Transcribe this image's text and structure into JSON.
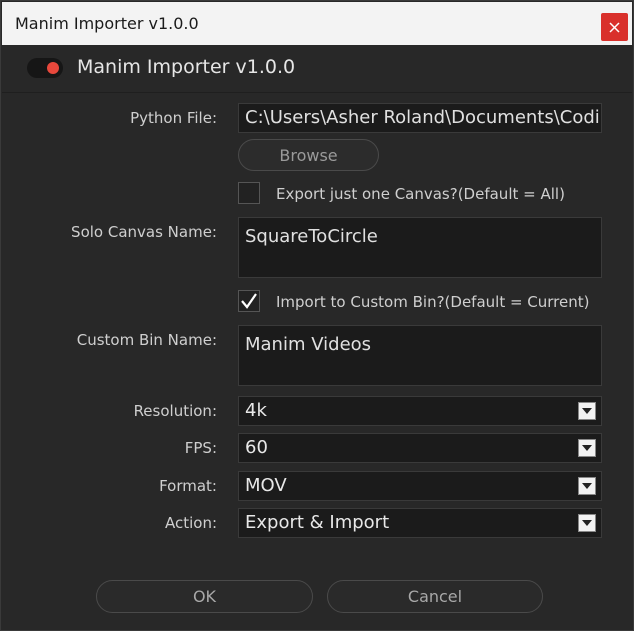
{
  "window": {
    "title": "Manim Importer v1.0.0",
    "close_icon": "close-icon"
  },
  "header": {
    "toggle_icon": "toggle-switch-icon",
    "title": "Manim Importer v1.0.0",
    "accent_color": "#e8483c"
  },
  "form": {
    "python_file": {
      "label": "Python File:",
      "value": "C:\\Users\\Asher Roland\\Documents\\Coding"
    },
    "browse_label": "Browse",
    "export_one_canvas": {
      "label": "Export just one Canvas?(Default = All)",
      "checked": false
    },
    "solo_canvas": {
      "label": "Solo Canvas Name:",
      "value": "SquareToCircle"
    },
    "import_custom_bin": {
      "label": "Import to Custom Bin?(Default = Current)",
      "checked": true
    },
    "custom_bin": {
      "label": "Custom Bin Name:",
      "value": "Manim Videos"
    },
    "resolution": {
      "label": "Resolution:",
      "value": "4k"
    },
    "fps": {
      "label": "FPS:",
      "value": "60"
    },
    "format": {
      "label": "Format:",
      "value": "MOV"
    },
    "action": {
      "label": "Action:",
      "value": "Export & Import"
    }
  },
  "footer": {
    "ok_label": "OK",
    "cancel_label": "Cancel"
  }
}
